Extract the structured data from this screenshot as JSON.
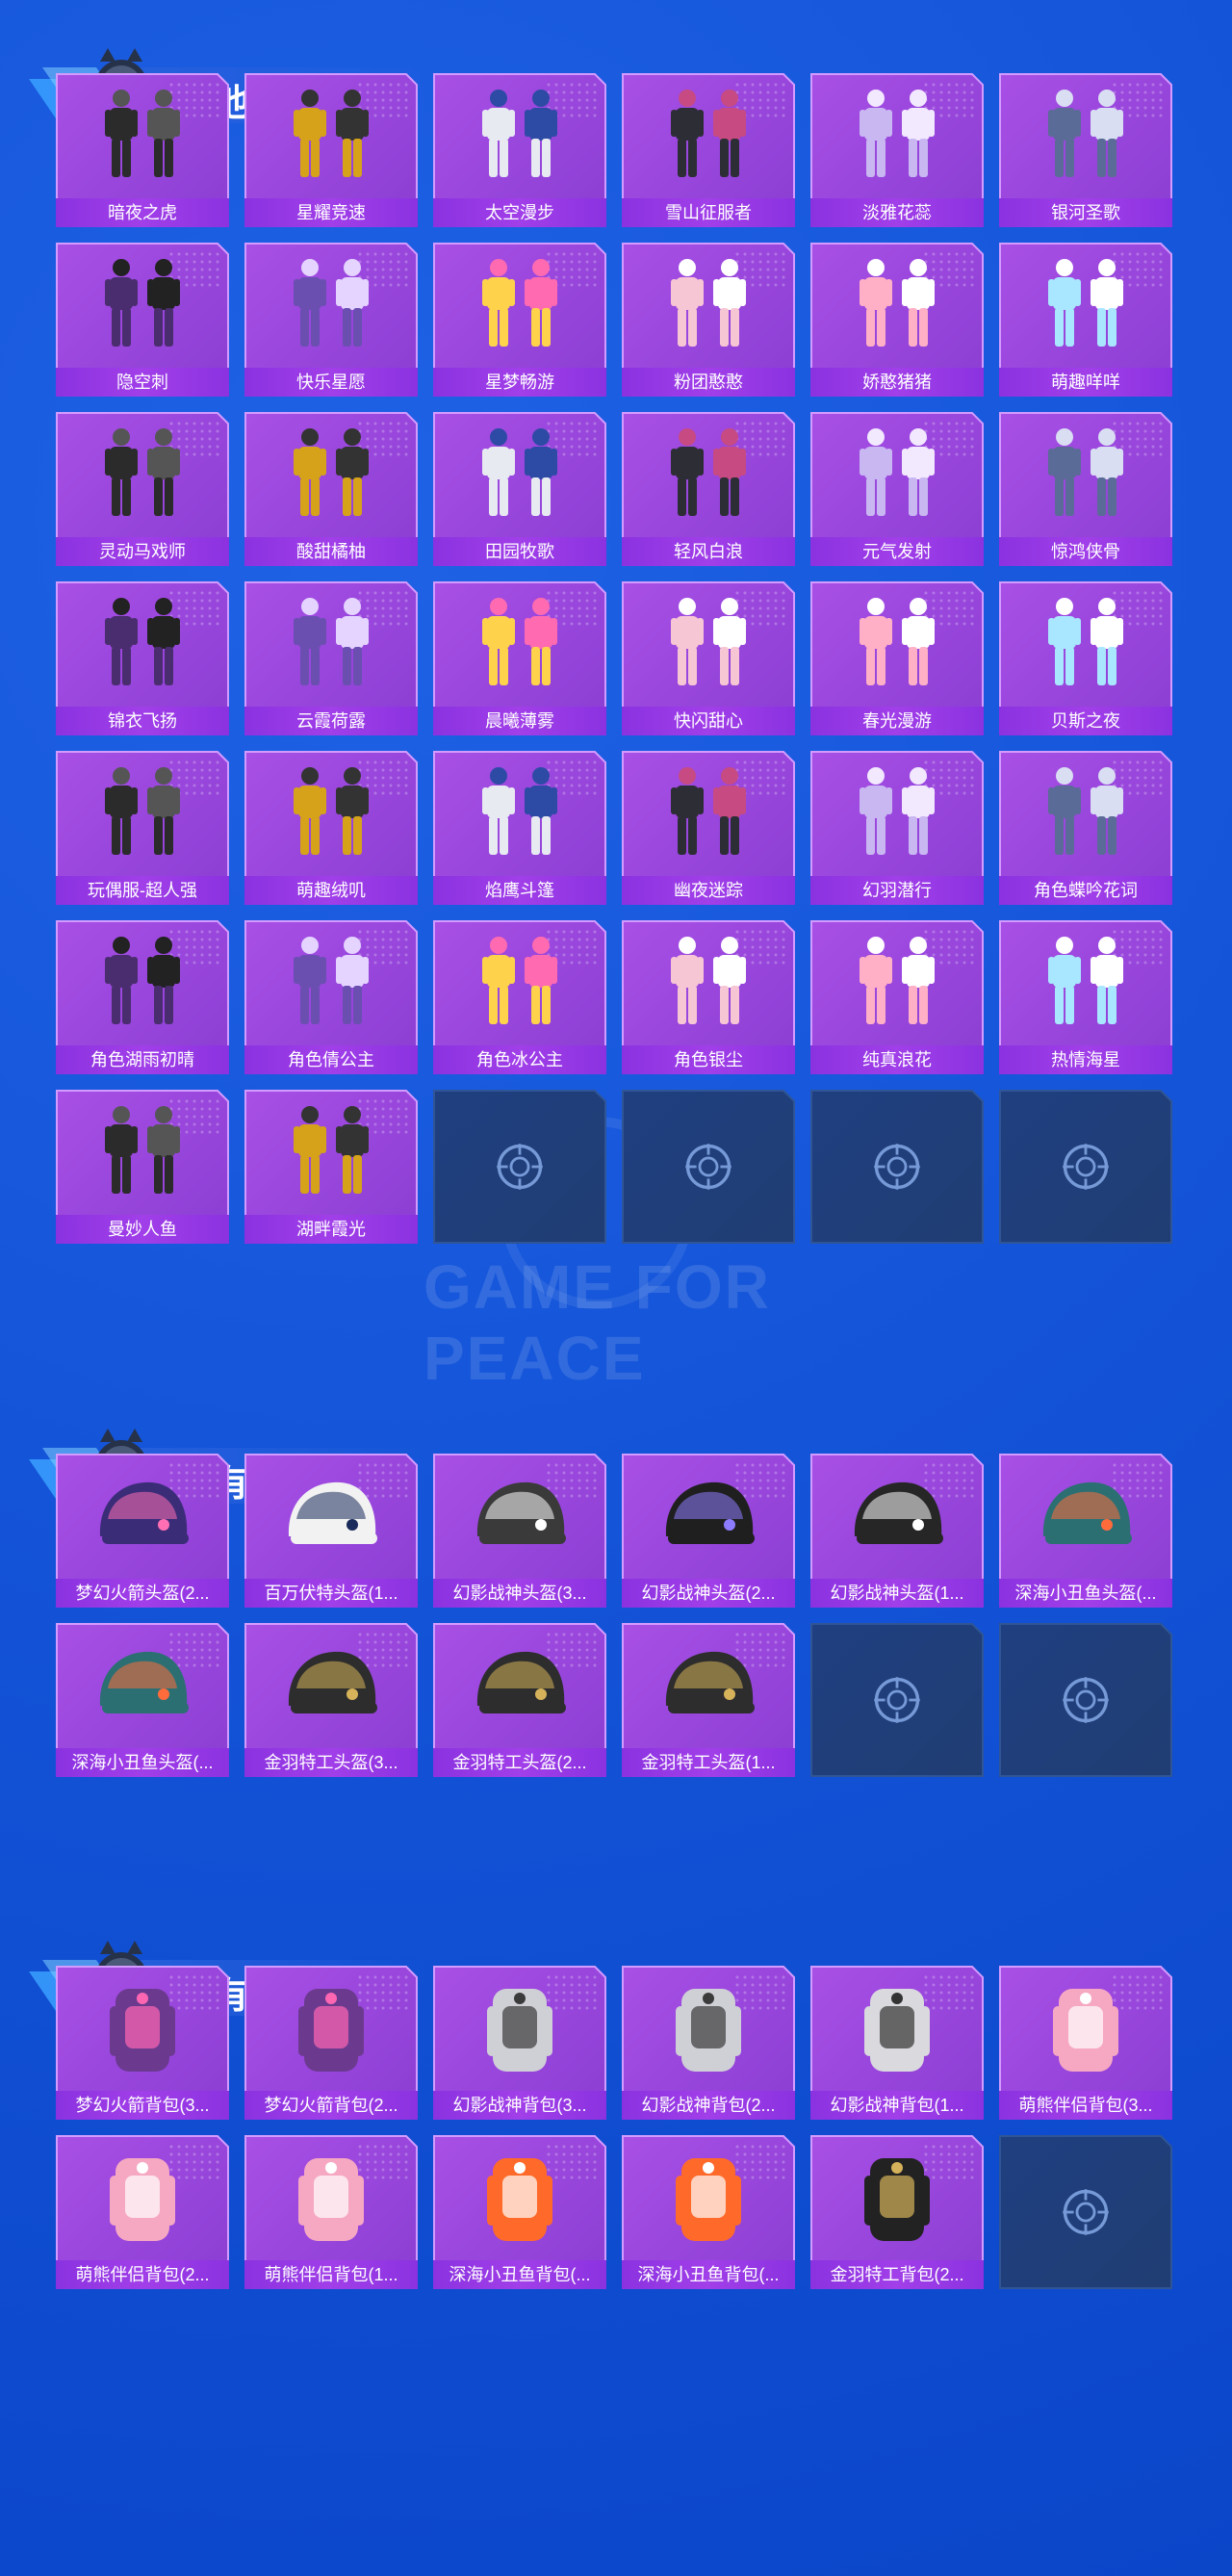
{
  "sections": [
    {
      "key": "other_outfits",
      "title": "其他套装",
      "items": [
        "暗夜之虎",
        "星耀竞速",
        "太空漫步",
        "雪山征服者",
        "淡雅花蕊",
        "银河圣歌",
        "隐空刺",
        "快乐星愿",
        "星梦畅游",
        "粉团憨憨",
        "娇憨猪猪",
        "萌趣咩咩",
        "灵动马戏师",
        "酸甜橘柚",
        "田园牧歌",
        "轻风白浪",
        "元气发射",
        "惊鸿侠骨",
        "锦衣飞扬",
        "云霞荷露",
        "晨曦薄雾",
        "快闪甜心",
        "春光漫游",
        "贝斯之夜",
        "玩偶服-超人强",
        "萌趣绒叽",
        "焰鹰斗篷",
        "幽夜迷踪",
        "幻羽潜行",
        "角色蝶吟花词",
        "角色湖雨初晴",
        "角色倩公主",
        "角色冰公主",
        "角色银尘",
        "纯真浪花",
        "热情海星",
        "曼妙人鱼",
        "湖畔霞光"
      ],
      "empty_slots": 4
    },
    {
      "key": "rare_helmets",
      "title": "稀有头盔",
      "items": [
        "梦幻火箭头盔(2...",
        "百万伏特头盔(1...",
        "幻影战神头盔(3...",
        "幻影战神头盔(2...",
        "幻影战神头盔(1...",
        "深海小丑鱼头盔(...",
        "深海小丑鱼头盔(...",
        "金羽特工头盔(3...",
        "金羽特工头盔(2...",
        "金羽特工头盔(1..."
      ],
      "empty_slots": 2
    },
    {
      "key": "rare_backpacks",
      "title": "稀有背包",
      "items": [
        "梦幻火箭背包(3...",
        "梦幻火箭背包(2...",
        "幻影战神背包(3...",
        "幻影战神背包(2...",
        "幻影战神背包(1...",
        "萌熊伴侣背包(3...",
        "萌熊伴侣背包(2...",
        "萌熊伴侣背包(1...",
        "深海小丑鱼背包(...",
        "深海小丑鱼背包(...",
        "金羽特工背包(2..."
      ],
      "empty_slots": 1
    }
  ],
  "watermark": "GAME FOR PEACE",
  "colors": {
    "background": "#1454d8",
    "tile": "#9a47dd",
    "label_bar": "#8b32e0",
    "empty_tile": "#203d73"
  }
}
